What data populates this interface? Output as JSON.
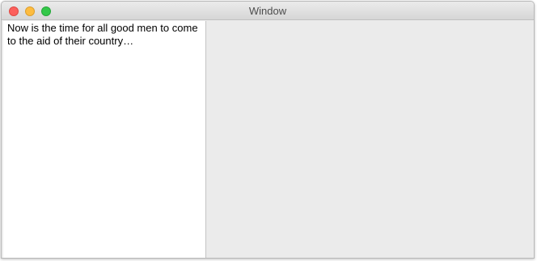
{
  "window": {
    "title": "Window",
    "controls": {
      "close": "close-button",
      "minimize": "minimize-button",
      "zoom": "zoom-button"
    }
  },
  "editor": {
    "text": "Now is the time for all good men to come to the aid of their country…"
  },
  "colors": {
    "close": "#fc605c",
    "minimize": "#fdbc40",
    "zoom": "#34c84a",
    "pane_background": "#ebebeb",
    "text_background": "#ffffff"
  }
}
